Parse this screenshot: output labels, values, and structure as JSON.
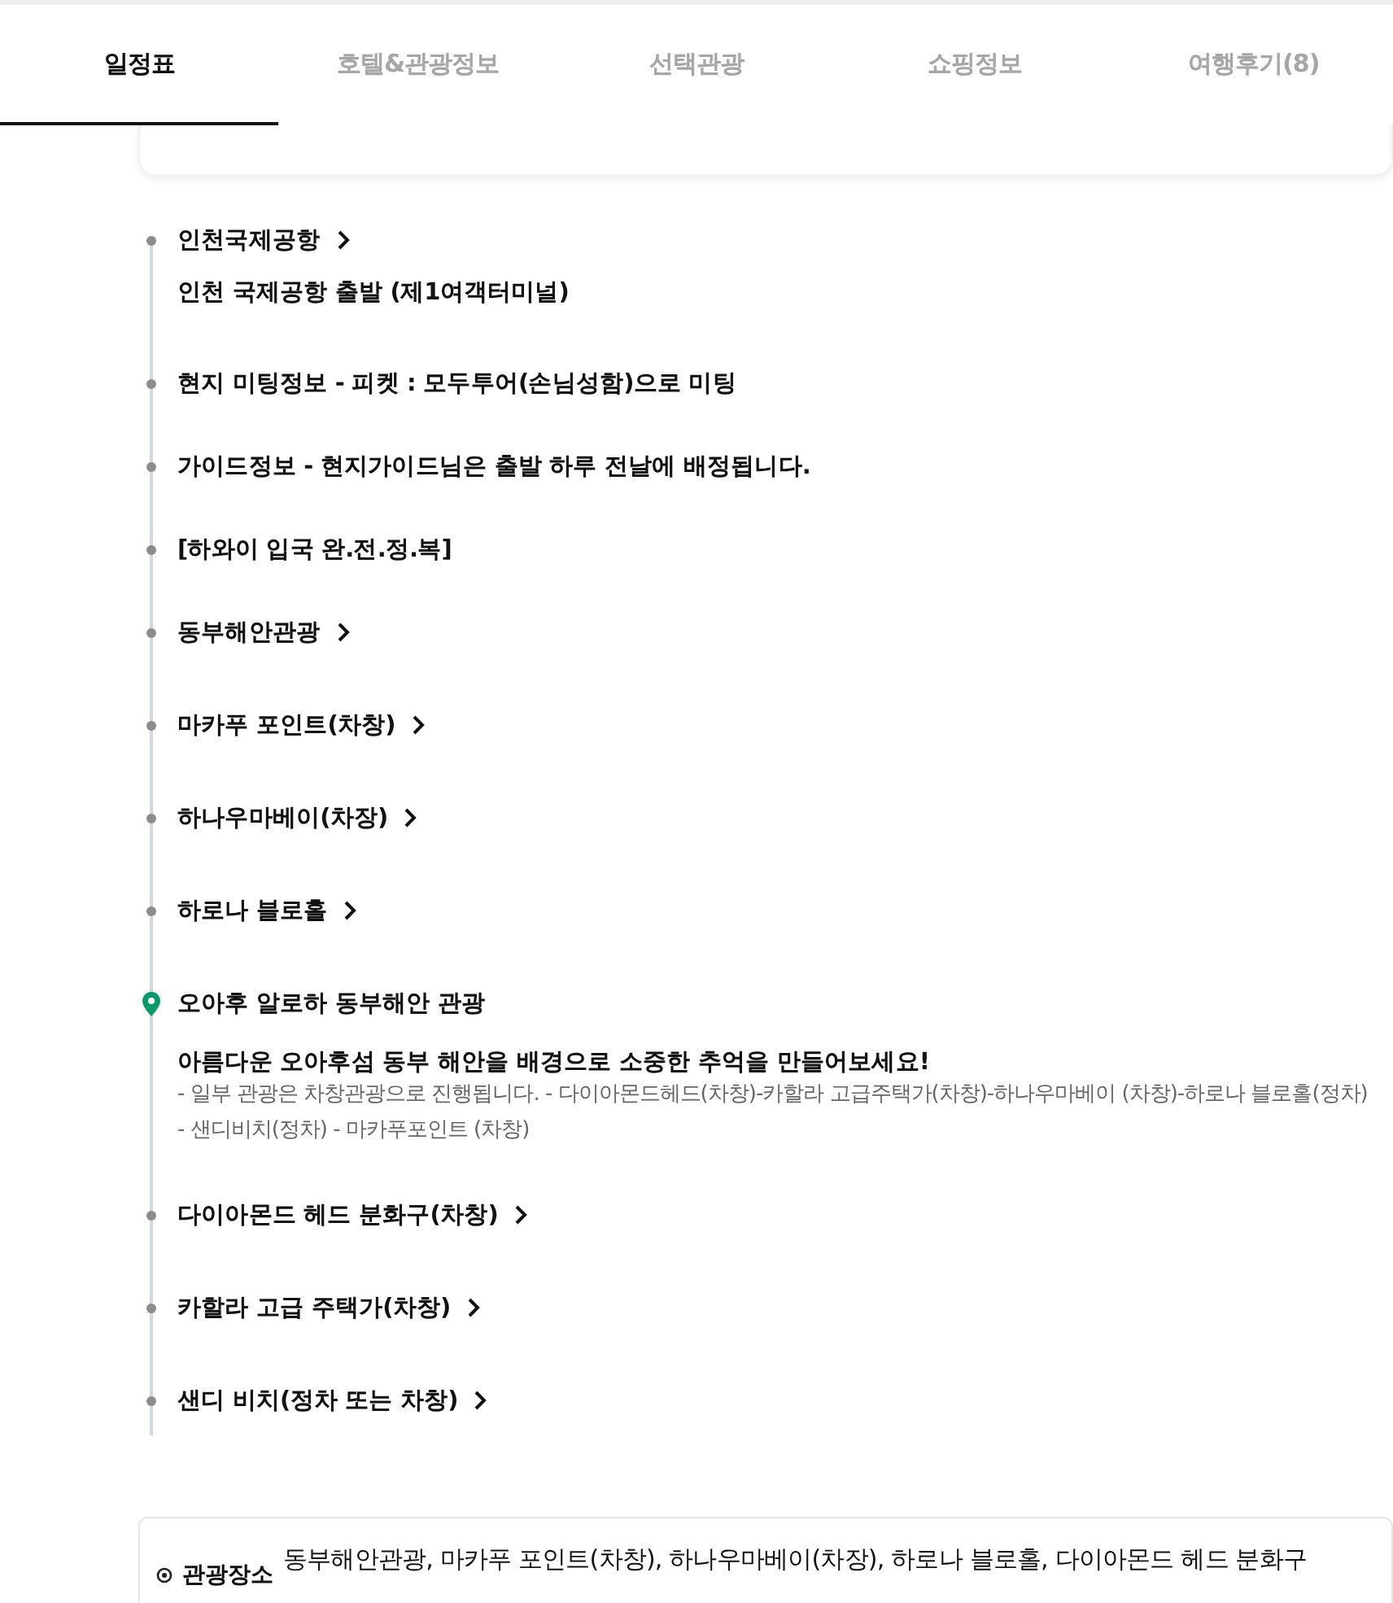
{
  "tabs": [
    {
      "label": "일정표",
      "selected": true
    },
    {
      "label": "호텔&관광정보",
      "selected": false
    },
    {
      "label": "선택관광",
      "selected": false
    },
    {
      "label": "쇼핑정보",
      "selected": false
    },
    {
      "label": "여행후기(8)",
      "selected": false
    }
  ],
  "timeline": [
    {
      "kind": "place",
      "title": "인천국제공항",
      "detail": "인천 국제공항 출발 (제1여객터미널)"
    },
    {
      "kind": "note",
      "title": "현지 미팅정보 - 피켓 : 모두투어(손님성함)으로 미팅"
    },
    {
      "kind": "note",
      "title": "가이드정보 - 현지가이드님은 출발 하루 전날에 배정됩니다."
    },
    {
      "kind": "note",
      "title": "[하와이 입국 완.전.정.복]"
    },
    {
      "kind": "place",
      "title": "동부해안관광"
    },
    {
      "kind": "place",
      "title": "마카푸 포인트(차창)"
    },
    {
      "kind": "place",
      "title": "하나우마베이(차장)"
    },
    {
      "kind": "place",
      "title": "하로나 블로홀"
    },
    {
      "kind": "highlight",
      "title": "오아후 알로하 동부해안 관광",
      "detail": "아름다운 오아후섬 동부 해안을 배경으로 소중한 추억을 만들어보세요!",
      "description": "- 일부 관광은 차창관광으로 진행됩니다. - 다이아몬드헤드(차창)-카할라 고급주택가(차창)-하나우마베이 (차창)-하로나 블로홀(정차) - 샌디비치(정차) - 마카푸포인트 (차창)"
    },
    {
      "kind": "place",
      "title": "다이아몬드 헤드 분화구(차창)"
    },
    {
      "kind": "place",
      "title": "카할라 고급 주택가(차창)"
    },
    {
      "kind": "place",
      "title": "샌디 비치(정차 또는 차창)"
    }
  ],
  "summary": {
    "label": "관광장소",
    "text": "동부해안관광, 마카푸 포인트(차창), 하나우마베이(차장), 하로나 블로홀, 다이아몬드 헤드 분화구"
  }
}
